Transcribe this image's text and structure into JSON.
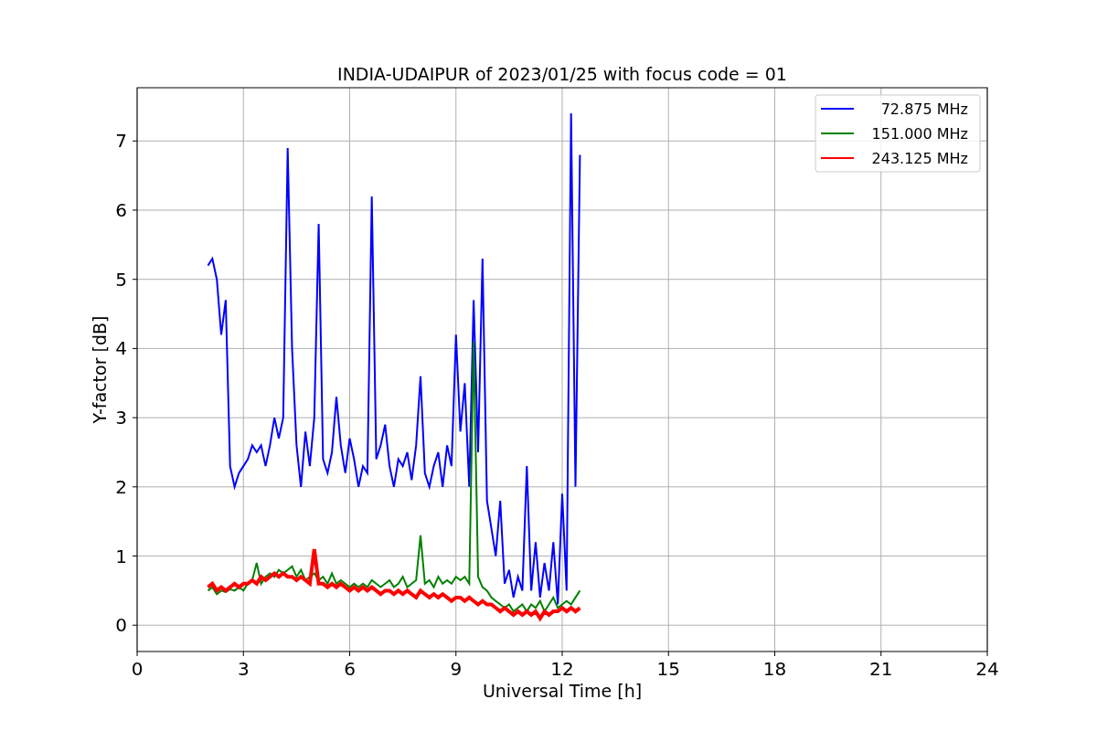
{
  "figure": {
    "chart_data": {
      "type": "line",
      "title": "INDIA-UDAIPUR of 2023/01/25 with focus code = 01",
      "xlabel": "Universal Time [h]",
      "ylabel": "Y-factor [dB]",
      "x": [
        2.0,
        2.125,
        2.25,
        2.375,
        2.5,
        2.625,
        2.75,
        2.875,
        3.0,
        3.125,
        3.25,
        3.375,
        3.5,
        3.625,
        3.75,
        3.875,
        4.0,
        4.125,
        4.25,
        4.375,
        4.5,
        4.625,
        4.75,
        4.875,
        5.0,
        5.125,
        5.25,
        5.375,
        5.5,
        5.625,
        5.75,
        5.875,
        6.0,
        6.125,
        6.25,
        6.375,
        6.5,
        6.625,
        6.75,
        6.875,
        7.0,
        7.125,
        7.25,
        7.375,
        7.5,
        7.625,
        7.75,
        7.875,
        8.0,
        8.125,
        8.25,
        8.375,
        8.5,
        8.625,
        8.75,
        8.875,
        9.0,
        9.125,
        9.25,
        9.375,
        9.5,
        9.625,
        9.75,
        9.875,
        10.0,
        10.125,
        10.25,
        10.375,
        10.5,
        10.625,
        10.75,
        10.875,
        11.0,
        11.125,
        11.25,
        11.375,
        11.5,
        11.625,
        11.75,
        11.875,
        12.0,
        12.125,
        12.25,
        12.375,
        12.5
      ],
      "series": [
        {
          "name": "72.875 MHz",
          "color": "#0000ff",
          "values": [
            5.2,
            5.3,
            5.0,
            4.2,
            4.7,
            2.3,
            2.0,
            2.2,
            2.3,
            2.4,
            2.6,
            2.5,
            2.6,
            2.3,
            2.6,
            3.0,
            2.7,
            3.0,
            6.9,
            4.0,
            2.6,
            2.0,
            2.8,
            2.3,
            3.0,
            5.8,
            2.4,
            2.2,
            2.5,
            3.3,
            2.6,
            2.2,
            2.7,
            2.4,
            2.0,
            2.3,
            2.2,
            6.2,
            2.4,
            2.6,
            2.9,
            2.3,
            2.0,
            2.4,
            2.3,
            2.5,
            2.1,
            2.6,
            3.6,
            2.2,
            2.0,
            2.3,
            2.5,
            2.0,
            2.6,
            2.3,
            4.2,
            2.8,
            3.5,
            2.0,
            4.7,
            2.5,
            5.3,
            1.8,
            1.4,
            1.0,
            1.8,
            0.6,
            0.8,
            0.4,
            0.7,
            0.5,
            2.3,
            0.5,
            1.2,
            0.4,
            0.9,
            0.5,
            1.2,
            0.3,
            1.9,
            0.5,
            7.4,
            2.0,
            6.8
          ]
        },
        {
          "name": "151.000 MHz",
          "color": "#008000",
          "values": [
            0.5,
            0.55,
            0.45,
            0.5,
            0.48,
            0.52,
            0.5,
            0.55,
            0.5,
            0.6,
            0.65,
            0.9,
            0.6,
            0.7,
            0.75,
            0.7,
            0.8,
            0.75,
            0.8,
            0.85,
            0.7,
            0.8,
            0.65,
            0.7,
            0.75,
            0.65,
            0.7,
            0.6,
            0.75,
            0.6,
            0.65,
            0.6,
            0.55,
            0.6,
            0.55,
            0.6,
            0.55,
            0.65,
            0.6,
            0.55,
            0.6,
            0.65,
            0.55,
            0.6,
            0.7,
            0.55,
            0.6,
            0.65,
            1.3,
            0.6,
            0.65,
            0.55,
            0.7,
            0.6,
            0.65,
            0.6,
            0.7,
            0.65,
            0.7,
            0.6,
            4.1,
            0.7,
            0.55,
            0.5,
            0.4,
            0.35,
            0.3,
            0.25,
            0.3,
            0.2,
            0.25,
            0.3,
            0.2,
            0.3,
            0.25,
            0.35,
            0.2,
            0.3,
            0.4,
            0.25,
            0.3,
            0.35,
            0.3,
            0.4,
            0.5
          ]
        },
        {
          "name": "243.125 MHz",
          "color": "#ff0000",
          "values": [
            0.55,
            0.6,
            0.5,
            0.55,
            0.5,
            0.55,
            0.6,
            0.55,
            0.6,
            0.6,
            0.65,
            0.6,
            0.7,
            0.65,
            0.7,
            0.75,
            0.7,
            0.75,
            0.7,
            0.7,
            0.65,
            0.7,
            0.65,
            0.6,
            1.1,
            0.6,
            0.6,
            0.55,
            0.6,
            0.55,
            0.6,
            0.55,
            0.5,
            0.55,
            0.5,
            0.55,
            0.5,
            0.55,
            0.5,
            0.45,
            0.5,
            0.5,
            0.45,
            0.5,
            0.45,
            0.5,
            0.45,
            0.4,
            0.5,
            0.45,
            0.4,
            0.45,
            0.4,
            0.45,
            0.4,
            0.35,
            0.4,
            0.4,
            0.35,
            0.4,
            0.35,
            0.3,
            0.35,
            0.3,
            0.3,
            0.25,
            0.2,
            0.25,
            0.2,
            0.15,
            0.2,
            0.15,
            0.2,
            0.15,
            0.2,
            0.1,
            0.2,
            0.15,
            0.2,
            0.2,
            0.25,
            0.2,
            0.25,
            0.2,
            0.25
          ]
        }
      ],
      "grid": true,
      "legend": true,
      "xlim": [
        0,
        24
      ],
      "ylim": [
        -0.38,
        7.77
      ],
      "xticks": [
        0,
        3,
        6,
        9,
        12,
        15,
        18,
        21,
        24
      ],
      "yticks": [
        0,
        1,
        2,
        3,
        4,
        5,
        6,
        7
      ]
    }
  }
}
